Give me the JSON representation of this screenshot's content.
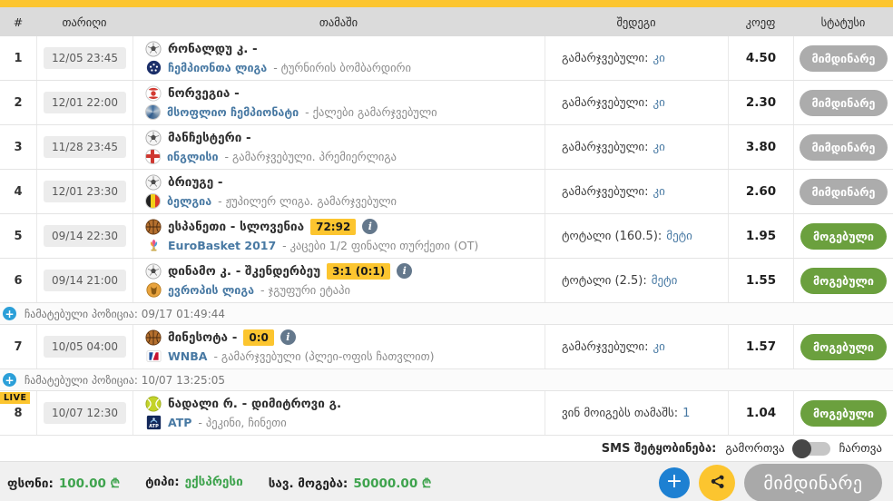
{
  "header": {
    "columns": [
      "#",
      "თარიღი",
      "თამაში",
      "შედეგი",
      "კოეფ",
      "სტატუსი"
    ]
  },
  "live_badge": "LIVE",
  "icons": {
    "plus": "+",
    "info": "i"
  },
  "rows": [
    {
      "num": "1",
      "date": "12/05 23:45",
      "sport_icon": "soccer-ball",
      "team": "რონალდუ კ. -",
      "league_icon": "champions-league",
      "league": "ჩემპიონთა ლიგა",
      "league_rest": "- ტურნირის ბომბარდირი",
      "result_label": "გამარჯვებული:",
      "result_value": "კი",
      "coef": "4.50",
      "status": "მიმდინარე",
      "status_type": "pending"
    },
    {
      "num": "2",
      "date": "12/01 22:00",
      "sport_icon": "handball-red-ball",
      "team": "ნორვეგია -",
      "league_icon": "world-championship",
      "league": "მსოფლიო ჩემპიონატი",
      "league_rest": "- ქალები გამარჯვებული",
      "result_label": "გამარჯვებული:",
      "result_value": "კი",
      "coef": "2.30",
      "status": "მიმდინარე",
      "status_type": "pending"
    },
    {
      "num": "3",
      "date": "11/28 23:45",
      "sport_icon": "soccer-ball",
      "team": "მანჩესტერი -",
      "league_icon": "england-flag",
      "league": "ინგლისი",
      "league_rest": "- გამარჯვებული. პრემიერლიგა",
      "result_label": "გამარჯვებული:",
      "result_value": "კი",
      "coef": "3.80",
      "status": "მიმდინარე",
      "status_type": "pending"
    },
    {
      "num": "4",
      "date": "12/01 23:30",
      "sport_icon": "soccer-ball",
      "team": "ბრიუგე -",
      "league_icon": "belgium-flag",
      "league": "ბელგია",
      "league_rest": "- ჟუპილერ ლიგა. გამარჯვებული",
      "result_label": "გამარჯვებული:",
      "result_value": "კი",
      "coef": "2.60",
      "status": "მიმდინარე",
      "status_type": "pending"
    },
    {
      "num": "5",
      "date": "09/14 22:30",
      "sport_icon": "basketball",
      "team": "ესპანეთი - სლოვენია",
      "score": "72:92",
      "league_icon": "eurobasket-trophy",
      "league": "EuroBasket 2017",
      "league_rest": "- კაცები 1/2 ფინალი თურქეთი (OT)",
      "result_label": "ტოტალი (160.5):",
      "result_value": "მეტი",
      "coef": "1.95",
      "status": "მოგებული",
      "status_type": "won"
    },
    {
      "num": "6",
      "date": "09/14 21:00",
      "sport_icon": "soccer-ball",
      "team": "დინამო კ. - შკენდერბეუ",
      "score": "3:1 (0:1)",
      "league_icon": "europa-league",
      "league": "ევროპის ლიგა",
      "league_rest": "- ჯგუფური ეტაპი",
      "result_label": "ტოტალი (2.5):",
      "result_value": "მეტი",
      "coef": "1.55",
      "status": "მოგებული",
      "status_type": "won"
    },
    {
      "num": "7",
      "date": "10/05 04:00",
      "sport_icon": "basketball",
      "team": "მინესოტა -",
      "score": "0:0",
      "league_icon": "wnba-logo",
      "league": "WNBA",
      "league_rest": "- გამარჯვებული (პლეი-ოფის ჩათვლით)",
      "result_label": "გამარჯვებული:",
      "result_value": "კი",
      "coef": "1.57",
      "status": "მოგებული",
      "status_type": "won"
    },
    {
      "num": "8",
      "date": "10/07 12:30",
      "sport_icon": "tennis-ball",
      "team": "ნადალი რ. - დიმიტროვი გ.",
      "live": "LIVE",
      "league_icon": "atp-logo",
      "league": "ATP",
      "league_rest": "- პეკინი, ჩინეთი",
      "result_label": "ვინ მოიგებს თამაშს:",
      "result_value": "1",
      "coef": "1.04",
      "status": "მოგებული",
      "status_type": "won"
    }
  ],
  "separators": [
    {
      "label": "ჩამატებული პოზიცია: 09/17 01:49:44"
    },
    {
      "label": "ჩამატებული პოზიცია: 10/07 13:25:05"
    }
  ],
  "sms": {
    "label": "SMS შეტყობინება:",
    "off_label": "გამორთვა",
    "on_label": "ჩართვა",
    "state": "off"
  },
  "footer": {
    "stake_label": "ფსონი:",
    "stake_value": "100.00 ₾",
    "type_label": "ტიპი:",
    "type_value": "ექსპრესი",
    "win_label": "სავ. მოგება:",
    "win_value": "50000.00 ₾",
    "main_button_label": "მიმდინარე"
  },
  "colors": {
    "accent_yellow": "#fcc52f",
    "won_green": "#6ba03e",
    "pending_gray": "#acacac",
    "link_blue": "#4879a3",
    "money_green": "#3ea34d",
    "plus_blue": "#1d80d2"
  }
}
